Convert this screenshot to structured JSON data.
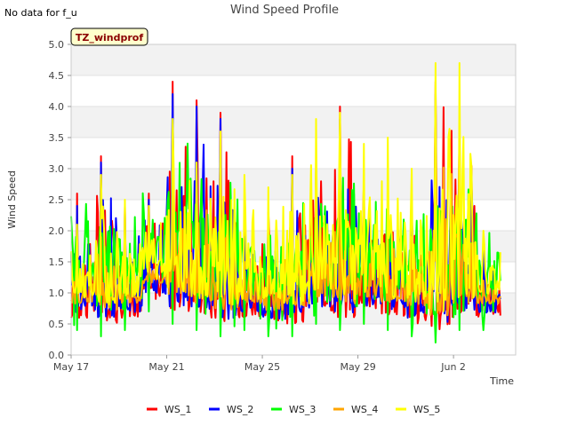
{
  "note": "No data for f_u",
  "badge": "TZ_windprof",
  "chart_data": {
    "type": "line",
    "title": "Wind Speed Profile",
    "xlabel": "Time",
    "ylabel": "Wind Speed",
    "ylim": [
      0.0,
      5.0
    ],
    "xlim": [
      "2024-05-17",
      "2024-06-04"
    ],
    "x_ticks": [
      "May 17",
      "May 21",
      "May 25",
      "May 29",
      "Jun 2"
    ],
    "y_ticks": [
      "0.0",
      "0.5",
      "1.0",
      "1.5",
      "2.0",
      "2.5",
      "3.0",
      "3.5",
      "4.0",
      "4.5",
      "5.0"
    ],
    "grid": true,
    "legend_position": "bottom",
    "x": [
      "2024-05-17",
      "2024-05-18",
      "2024-05-19",
      "2024-05-20",
      "2024-05-21",
      "2024-05-22",
      "2024-05-23",
      "2024-05-24",
      "2024-05-25",
      "2024-05-26",
      "2024-05-27",
      "2024-05-28",
      "2024-05-29",
      "2024-05-30",
      "2024-05-31",
      "2024-06-01",
      "2024-06-02",
      "2024-06-03"
    ],
    "series": [
      {
        "name": "WS_1",
        "color": "#ff0000",
        "values": [
          2.6,
          3.2,
          2.4,
          2.6,
          4.4,
          4.1,
          3.9,
          2.0,
          2.3,
          3.2,
          3.1,
          4.0,
          2.9,
          2.7,
          2.5,
          4.4,
          3.6,
          1.8
        ]
      },
      {
        "name": "WS_2",
        "color": "#0000ff",
        "values": [
          2.4,
          3.1,
          2.3,
          2.5,
          4.2,
          4.0,
          3.8,
          1.9,
          2.2,
          3.0,
          3.0,
          3.8,
          2.8,
          2.6,
          2.4,
          4.2,
          3.5,
          1.7
        ]
      },
      {
        "name": "WS_3",
        "color": "#00ff00",
        "values": [
          0.4,
          0.3,
          0.4,
          0.7,
          0.5,
          0.4,
          0.3,
          0.4,
          0.3,
          0.3,
          0.5,
          0.4,
          0.5,
          0.4,
          0.3,
          0.2,
          0.4,
          0.4
        ]
      },
      {
        "name": "WS_4",
        "color": "#ffa500",
        "values": [
          1.5,
          1.9,
          1.6,
          1.8,
          3.0,
          2.6,
          2.8,
          1.5,
          1.9,
          2.4,
          2.5,
          3.2,
          2.1,
          2.0,
          1.9,
          3.4,
          2.6,
          1.2
        ]
      },
      {
        "name": "WS_5",
        "color": "#ffff00",
        "values": [
          2.1,
          2.9,
          2.5,
          2.4,
          3.8,
          3.1,
          3.6,
          2.9,
          2.7,
          2.9,
          3.8,
          3.9,
          3.4,
          3.5,
          3.0,
          4.7,
          4.7,
          2.0
        ]
      }
    ]
  }
}
